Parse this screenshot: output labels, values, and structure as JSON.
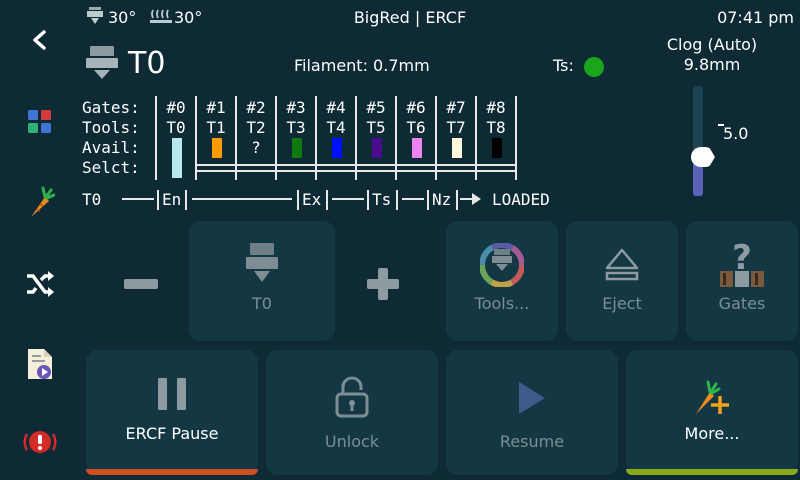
{
  "header": {
    "nozzle_temp": "30°",
    "bed_temp": "30°",
    "title": "BigRed | ERCF",
    "time": "07:41 pm"
  },
  "tool": {
    "current": "T0",
    "filament_label": "Filament: 0.7mm",
    "ts_label": "Ts:",
    "clog_title": "Clog (Auto)",
    "clog_value": "9.8mm",
    "slider_value": "5.0",
    "colors": {
      "ts_indicator": "#1aa51a",
      "slider_fill": "#5b62b8"
    }
  },
  "gates": {
    "row_labels": [
      "Gates:",
      "Tools:",
      "Avail:",
      "Selct:"
    ],
    "columns": [
      {
        "gate": "#0",
        "tool": "T0",
        "avail": "",
        "color": "#b8e8ef"
      },
      {
        "gate": "#1",
        "tool": "T1",
        "avail": "",
        "color": "#ff9a00"
      },
      {
        "gate": "#2",
        "tool": "T2",
        "avail": "?",
        "color": ""
      },
      {
        "gate": "#3",
        "tool": "T3",
        "avail": "",
        "color": "#0e7a0e"
      },
      {
        "gate": "#4",
        "tool": "T4",
        "avail": "",
        "color": "#0010ff"
      },
      {
        "gate": "#5",
        "tool": "T5",
        "avail": "",
        "color": "#4a0c8f"
      },
      {
        "gate": "#6",
        "tool": "T6",
        "avail": "",
        "color": "#ee82ee"
      },
      {
        "gate": "#7",
        "tool": "T7",
        "avail": "",
        "color": "#fff8dc"
      },
      {
        "gate": "#8",
        "tool": "T8",
        "avail": "",
        "color": "#000000"
      }
    ]
  },
  "status_line": {
    "tool": "T0",
    "en": "En",
    "ex": "Ex",
    "ts": "Ts",
    "nz": "Nz",
    "state": "LOADED"
  },
  "buttons": {
    "tool_select": "T0",
    "tools": "Tools...",
    "eject": "Eject",
    "gates": "Gates",
    "pause": "ERCF Pause",
    "unlock": "Unlock",
    "resume": "Resume",
    "more": "More..."
  },
  "icons": {
    "back": "back-chevron-icon",
    "main": "main-menu-icon",
    "extrude": "carrot-icon",
    "move": "shuffle-icon",
    "print": "file-play-icon",
    "emergency": "emergency-stop-icon"
  },
  "accent_colors": {
    "pause_bar": "#cf4d1f",
    "more_bar": "#8aa81c",
    "emergency": "#d32a2a"
  }
}
